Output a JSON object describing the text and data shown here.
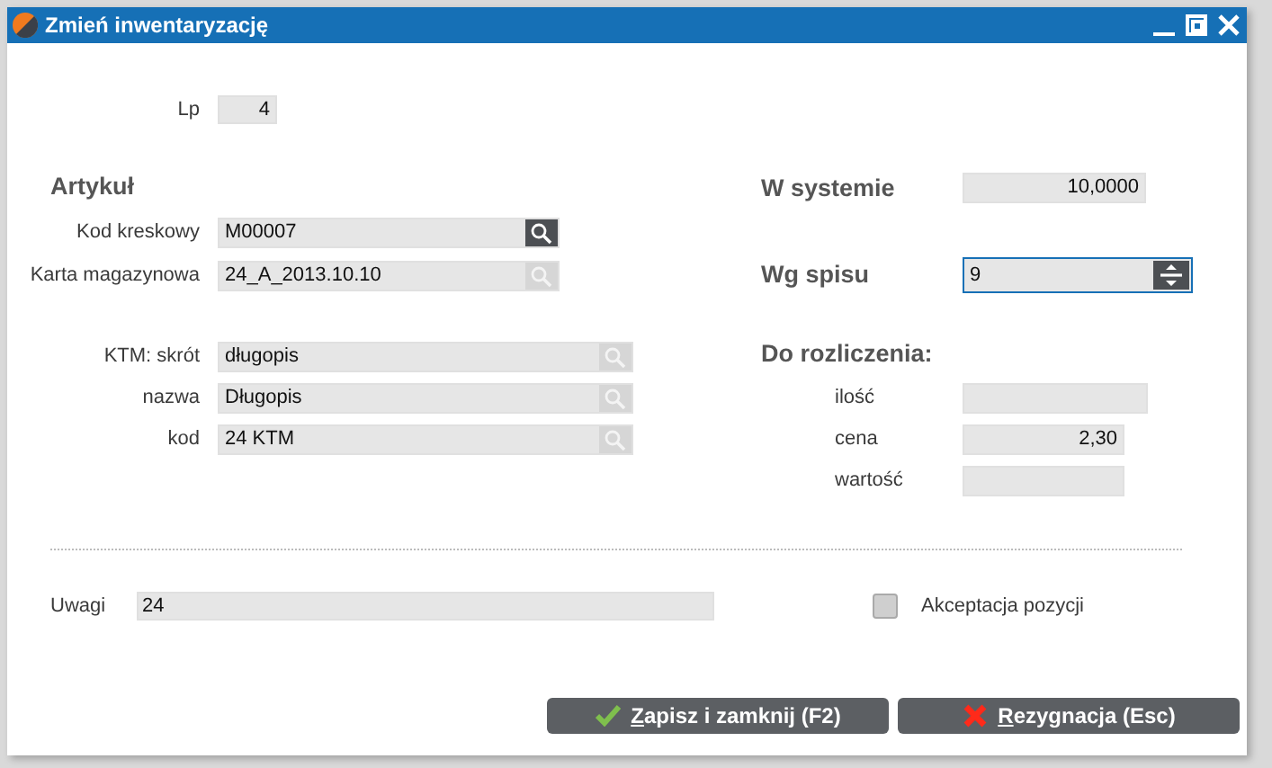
{
  "window": {
    "title": "Zmień inwentaryzację"
  },
  "lp": {
    "label": "Lp",
    "value": "4"
  },
  "article": {
    "heading": "Artykuł",
    "fields": [
      {
        "label": "Kod kreskowy",
        "value": "M00007",
        "lookup_enabled": true
      },
      {
        "label": "Karta magazynowa",
        "value": "24_A_2013.10.10",
        "lookup_enabled": false
      }
    ]
  },
  "ktm_fields": [
    {
      "label": "KTM: skrót",
      "value": "długopis",
      "lookup_enabled": false
    },
    {
      "label": "nazwa",
      "value": "Długopis",
      "lookup_enabled": false
    },
    {
      "label": "kod",
      "value": "24 KTM",
      "lookup_enabled": false
    }
  ],
  "stock": {
    "system": {
      "label": "W systemie",
      "value": "10,0000"
    },
    "count": {
      "label": "Wg spisu",
      "value": "9",
      "focused": true
    },
    "settlement": {
      "heading": "Do rozliczenia:",
      "rows": [
        {
          "label": "ilość"
        },
        {
          "label": "cena",
          "value": "2,30"
        },
        {
          "label": "wartość"
        }
      ]
    }
  },
  "notes": {
    "label": "Uwagi",
    "value": "24"
  },
  "acceptance": {
    "label": "Akceptacja pozycji",
    "checked": false
  },
  "buttons": [
    {
      "kind": "save",
      "label": "Zapisz i zamknij (F2)",
      "accelerator_underlined": true
    },
    {
      "kind": "cancel",
      "label": "Rezygnacja (Esc)",
      "accelerator_underlined": true
    }
  ]
}
